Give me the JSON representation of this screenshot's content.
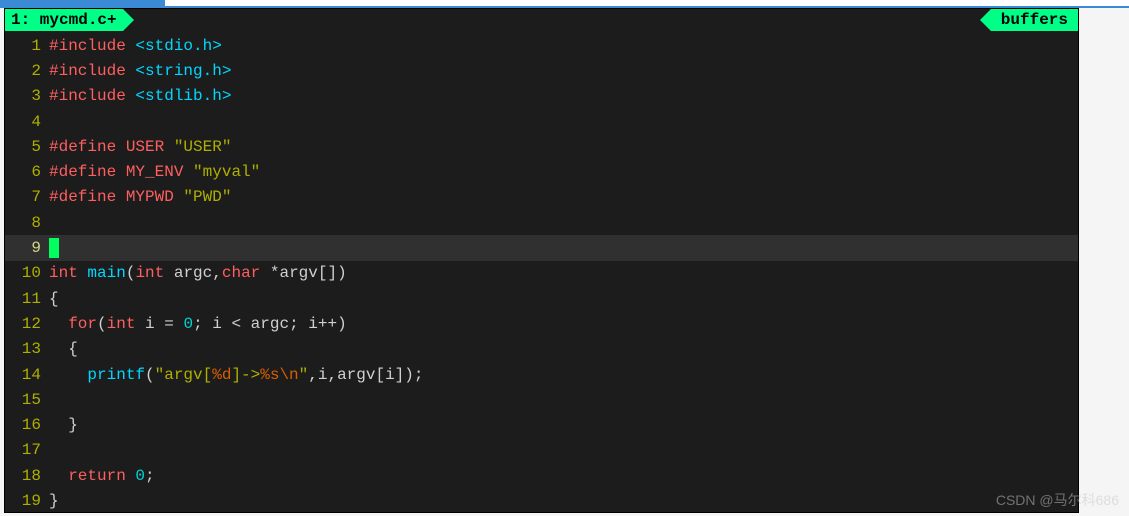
{
  "tab": {
    "left_label": "1: mycmd.c+",
    "right_label": "buffers"
  },
  "cursor_line": 9,
  "lines": [
    {
      "n": 1,
      "tokens": [
        [
          "c-pp",
          "#include "
        ],
        [
          "c-inc",
          "<stdio.h>"
        ]
      ]
    },
    {
      "n": 2,
      "tokens": [
        [
          "c-pp",
          "#include "
        ],
        [
          "c-inc",
          "<string.h>"
        ]
      ]
    },
    {
      "n": 3,
      "tokens": [
        [
          "c-pp",
          "#include "
        ],
        [
          "c-inc",
          "<stdlib.h>"
        ]
      ]
    },
    {
      "n": 4,
      "tokens": []
    },
    {
      "n": 5,
      "tokens": [
        [
          "c-pp",
          "#define USER "
        ],
        [
          "c-str",
          "\"USER\""
        ]
      ]
    },
    {
      "n": 6,
      "tokens": [
        [
          "c-pp",
          "#define MY_ENV "
        ],
        [
          "c-str",
          "\"myval\""
        ]
      ]
    },
    {
      "n": 7,
      "tokens": [
        [
          "c-pp",
          "#define MYPWD "
        ],
        [
          "c-str",
          "\"PWD\""
        ]
      ]
    },
    {
      "n": 8,
      "tokens": []
    },
    {
      "n": 9,
      "tokens": [
        [
          "cursor",
          ""
        ]
      ]
    },
    {
      "n": 10,
      "tokens": [
        [
          "c-type",
          "int"
        ],
        [
          "",
          " "
        ],
        [
          "c-func",
          "main"
        ],
        [
          "",
          "("
        ],
        [
          "c-type",
          "int"
        ],
        [
          "",
          " argc,"
        ],
        [
          "c-type",
          "char"
        ],
        [
          "",
          " *argv[])"
        ]
      ]
    },
    {
      "n": 11,
      "tokens": [
        [
          "",
          "{"
        ]
      ]
    },
    {
      "n": 12,
      "tokens": [
        [
          "",
          "  "
        ],
        [
          "c-kw",
          "for"
        ],
        [
          "",
          "("
        ],
        [
          "c-type",
          "int"
        ],
        [
          "",
          " i = "
        ],
        [
          "c-num",
          "0"
        ],
        [
          "",
          "; i < argc; i++)"
        ]
      ]
    },
    {
      "n": 13,
      "tokens": [
        [
          "",
          "  {"
        ]
      ]
    },
    {
      "n": 14,
      "tokens": [
        [
          "",
          "    "
        ],
        [
          "c-call",
          "printf"
        ],
        [
          "",
          "("
        ],
        [
          "c-str",
          "\"argv["
        ],
        [
          "c-fmt",
          "%d"
        ],
        [
          "c-str",
          "]->"
        ],
        [
          "c-fmt",
          "%s"
        ],
        [
          "c-esc",
          "\\n"
        ],
        [
          "c-str",
          "\""
        ],
        [
          "",
          ",i,argv[i]);"
        ]
      ]
    },
    {
      "n": 15,
      "tokens": []
    },
    {
      "n": 16,
      "tokens": [
        [
          "",
          "  }"
        ]
      ]
    },
    {
      "n": 17,
      "tokens": []
    },
    {
      "n": 18,
      "tokens": [
        [
          "",
          "  "
        ],
        [
          "c-kw",
          "return"
        ],
        [
          "",
          " "
        ],
        [
          "c-num",
          "0"
        ],
        [
          "",
          ";"
        ]
      ]
    },
    {
      "n": 19,
      "tokens": [
        [
          "",
          "}"
        ]
      ]
    }
  ],
  "watermark": "CSDN @马尔科686"
}
